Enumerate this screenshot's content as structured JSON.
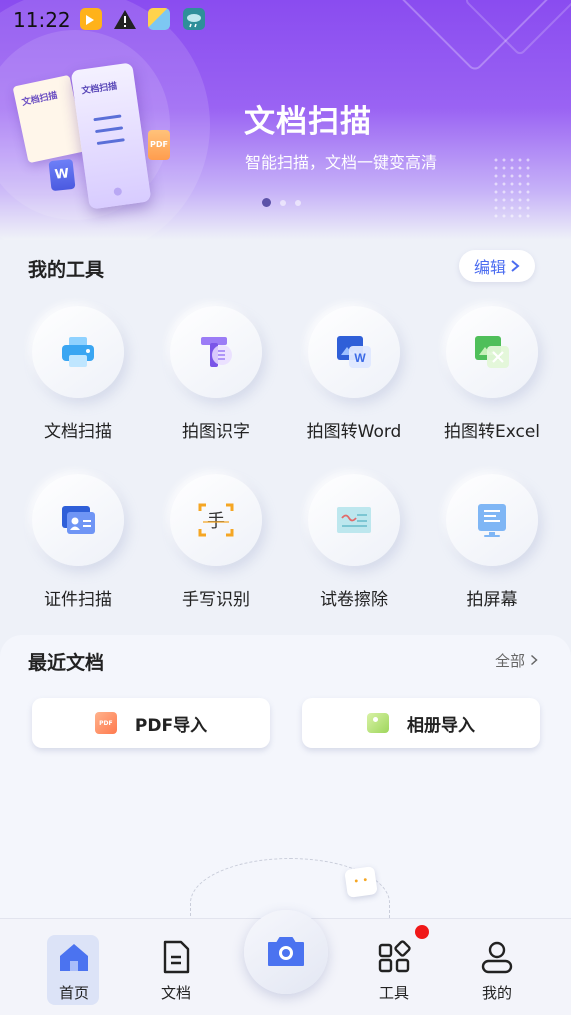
{
  "status_bar": {
    "time": "11:22"
  },
  "banner": {
    "title": "文档扫描",
    "subtitle": "智能扫描，文档一键变高清",
    "illustration_doc_text": "文档扫描",
    "illustration_phone_text": "文档扫描",
    "word_badge": "W",
    "pdf_badge": "PDF",
    "pager_count": 3,
    "pager_active_index": 0
  },
  "tools": {
    "title": "我的工具",
    "edit_label": "编辑",
    "items": [
      {
        "label": "文档扫描",
        "icon": "printer-icon"
      },
      {
        "label": "拍图识字",
        "icon": "text-recognition-icon"
      },
      {
        "label": "拍图转Word",
        "icon": "word-icon"
      },
      {
        "label": "拍图转Excel",
        "icon": "excel-icon"
      },
      {
        "label": "证件扫描",
        "icon": "id-card-icon"
      },
      {
        "label": "手写识别",
        "icon": "handwriting-icon"
      },
      {
        "label": "试卷擦除",
        "icon": "exam-erase-icon"
      },
      {
        "label": "拍屏幕",
        "icon": "screen-capture-icon"
      }
    ],
    "handwriting_glyph": "手",
    "word_glyph": "W"
  },
  "recent": {
    "title": "最近文档",
    "all_label": "全部",
    "pdf_import_label": "PDF导入",
    "pdf_icon_text": "PDF",
    "album_import_label": "相册导入"
  },
  "bottom_nav": {
    "items": [
      {
        "label": "首页",
        "icon": "home-icon",
        "active": true
      },
      {
        "label": "文档",
        "icon": "document-icon",
        "active": false
      },
      {
        "label": "工具",
        "icon": "tools-icon",
        "active": false,
        "badge": true
      },
      {
        "label": "我的",
        "icon": "profile-icon",
        "active": false
      }
    ],
    "camera_icon": "camera-icon"
  },
  "colors": {
    "accent": "#4b6cf0",
    "banner_purple": "#8a4cf0",
    "badge_red": "#f01818"
  }
}
